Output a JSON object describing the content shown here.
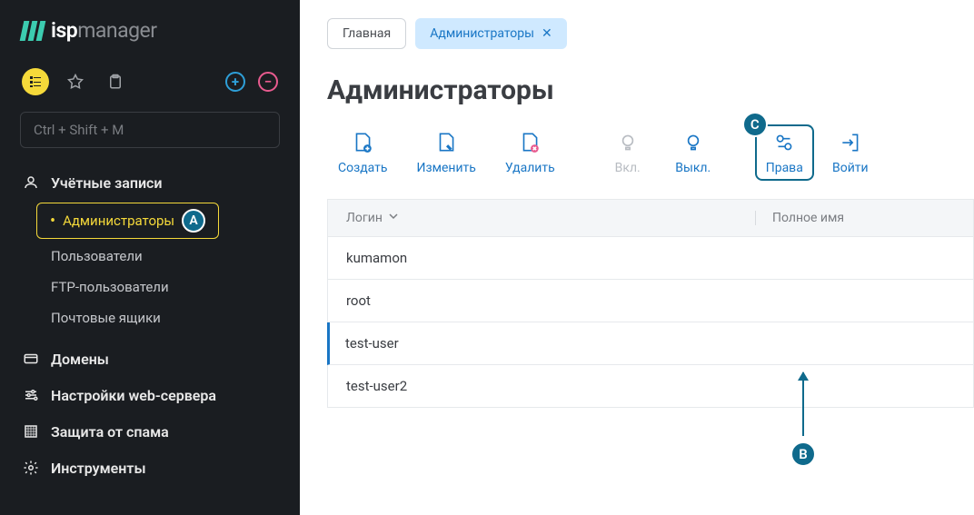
{
  "logo": {
    "bold": "isp",
    "light": "manager"
  },
  "search": {
    "placeholder": "Ctrl + Shift + M"
  },
  "nav": {
    "accounts": {
      "label": "Учётные записи",
      "items": [
        {
          "label": "Администраторы",
          "active": true
        },
        {
          "label": "Пользователи"
        },
        {
          "label": "FTP-пользователи"
        },
        {
          "label": "Почтовые ящики"
        }
      ]
    },
    "domains": {
      "label": "Домены"
    },
    "webserver": {
      "label": "Настройки web-сервера"
    },
    "spam": {
      "label": "Защита от спама"
    },
    "tools": {
      "label": "Инструменты"
    }
  },
  "tabs": {
    "home": "Главная",
    "admins": "Администраторы"
  },
  "page": {
    "title": "Администраторы"
  },
  "toolbar": {
    "create": "Создать",
    "edit": "Изменить",
    "delete": "Удалить",
    "on": "Вкл.",
    "off": "Выкл.",
    "rights": "Права",
    "login": "Войти"
  },
  "table": {
    "cols": {
      "login": "Логин",
      "name": "Полное имя"
    },
    "rows": [
      {
        "login": "kumamon"
      },
      {
        "login": "root"
      },
      {
        "login": "test-user",
        "selected": true
      },
      {
        "login": "test-user2"
      }
    ]
  },
  "annotations": {
    "a": "A",
    "b": "B",
    "c": "C"
  }
}
